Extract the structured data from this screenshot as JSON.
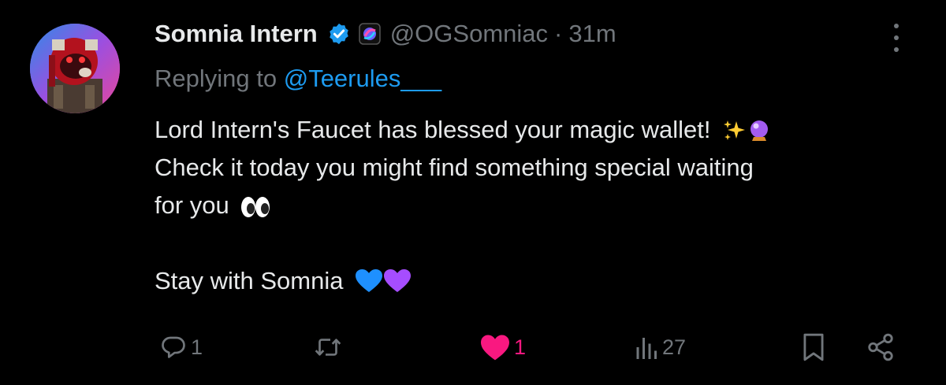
{
  "tweet": {
    "author_name": "Somnia Intern",
    "handle": "@OGSomniac",
    "separator": "·",
    "time": "31m",
    "replying_prefix": "Replying to",
    "replying_handle": "@Teerules___",
    "lines": [
      "Lord Intern's Faucet has blessed your magic wallet!",
      "Check it today you might find something special waiting",
      "for you",
      "Stay with Somnia"
    ],
    "emoji_names": [
      "sparkles",
      "crystal-ball",
      "eyes",
      "blue-heart",
      "purple-heart"
    ]
  },
  "actions": {
    "reply_count": "1",
    "repost_count": "",
    "like_count": "1",
    "views_count": "27"
  },
  "colors": {
    "background": "#000000",
    "text": "#e7e9ea",
    "muted": "#71767b",
    "link": "#1d9bf0",
    "like": "#f91880"
  },
  "icons": [
    "verified-badge-icon",
    "affiliate-logo-icon",
    "more-icon",
    "reply-icon",
    "repost-icon",
    "like-icon",
    "views-icon",
    "bookmark-icon",
    "share-icon"
  ]
}
